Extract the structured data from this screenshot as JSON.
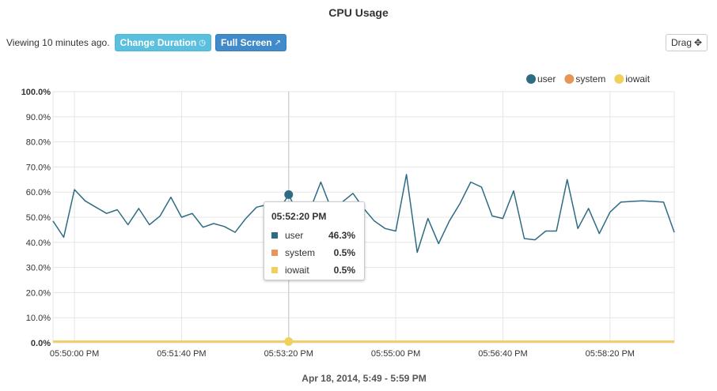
{
  "title": "CPU Usage",
  "toolbar": {
    "viewing_text": "Viewing 10 minutes ago.",
    "change_duration_label": "Change Duration",
    "full_screen_label": "Full Screen",
    "drag_label": "Drag"
  },
  "icons": {
    "clock": "clock-icon",
    "expand": "expand-icon",
    "move": "move-icon"
  },
  "tooltip": {
    "time": "05:52:20 PM",
    "rows": [
      {
        "name": "user",
        "value": "46.3%",
        "color": "#2e6c84"
      },
      {
        "name": "system",
        "value": "0.5%",
        "color": "#e8955a"
      },
      {
        "name": "iowait",
        "value": "0.5%",
        "color": "#f2d05e"
      }
    ]
  },
  "date_range": "Apr 18, 2014, 5:49 - 5:59 PM",
  "chart_data": {
    "type": "line",
    "title": "CPU Usage",
    "xlabel": "Apr 18, 2014, 5:49 - 5:59 PM",
    "ylabel": "",
    "ylim": [
      0,
      100
    ],
    "y_ticks": [
      "0.0%",
      "10.0%",
      "20.0%",
      "30.0%",
      "40.0%",
      "50.0%",
      "60.0%",
      "70.0%",
      "80.0%",
      "90.0%",
      "100.0%"
    ],
    "x_ticks": [
      "05:50:00 PM",
      "05:51:40 PM",
      "05:53:20 PM",
      "05:55:00 PM",
      "05:56:40 PM",
      "05:58:20 PM"
    ],
    "x_tick_seconds": [
      60,
      160,
      260,
      360,
      460,
      560
    ],
    "x_range_seconds": [
      40,
      620
    ],
    "x_seconds": [
      40,
      50,
      60,
      70,
      80,
      90,
      100,
      110,
      120,
      130,
      140,
      150,
      160,
      170,
      180,
      190,
      200,
      210,
      220,
      230,
      240,
      250,
      260,
      270,
      280,
      290,
      300,
      310,
      320,
      330,
      340,
      350,
      360,
      370,
      380,
      390,
      400,
      410,
      420,
      430,
      440,
      450,
      460,
      470,
      480,
      490,
      500,
      510,
      520,
      530,
      540,
      550,
      560,
      570,
      580,
      590,
      600,
      610,
      620
    ],
    "grid": true,
    "legend_position": "top-right",
    "highlight_index": 22,
    "series": [
      {
        "name": "user",
        "color": "#2e6c84",
        "values": [
          48.5,
          42,
          61,
          56.5,
          54,
          51.5,
          53,
          47,
          53.5,
          47,
          50.5,
          58,
          50,
          51.5,
          46,
          47.5,
          46.3,
          44,
          49.5,
          54,
          55,
          52,
          59,
          50,
          53,
          64,
          53,
          56,
          59.5,
          53.5,
          48.5,
          45.5,
          44.5,
          67,
          36,
          49.5,
          39.5,
          48.5,
          55.5,
          64,
          62,
          50.5,
          49.5,
          60.5,
          41.5,
          41,
          44.5,
          44.5,
          65,
          45.5,
          53.5,
          43.5,
          52,
          56,
          56.3,
          56.5,
          56.3,
          56,
          44
        ]
      },
      {
        "name": "system",
        "color": "#e8955a",
        "values": [
          0.5,
          0.5,
          0.5,
          0.5,
          0.5,
          0.5,
          0.5,
          0.5,
          0.5,
          0.5,
          0.5,
          0.5,
          0.5,
          0.5,
          0.5,
          0.5,
          0.5,
          0.5,
          0.5,
          0.5,
          0.5,
          0.5,
          0.5,
          0.5,
          0.5,
          0.5,
          0.5,
          0.5,
          0.5,
          0.5,
          0.5,
          0.5,
          0.5,
          0.5,
          0.5,
          0.5,
          0.5,
          0.5,
          0.5,
          0.5,
          0.5,
          0.5,
          0.5,
          0.5,
          0.5,
          0.5,
          0.5,
          0.5,
          0.5,
          0.5,
          0.5,
          0.5,
          0.5,
          0.5,
          0.5,
          0.5,
          0.5,
          0.5,
          0.5
        ]
      },
      {
        "name": "iowait",
        "color": "#f2d05e",
        "values": [
          0.5,
          0.5,
          0.5,
          0.5,
          0.5,
          0.5,
          0.5,
          0.5,
          0.5,
          0.5,
          0.5,
          0.5,
          0.5,
          0.5,
          0.5,
          0.5,
          0.5,
          0.5,
          0.5,
          0.5,
          0.5,
          0.5,
          0.5,
          0.5,
          0.5,
          0.5,
          0.5,
          0.5,
          0.5,
          0.5,
          0.5,
          0.5,
          0.5,
          0.5,
          0.5,
          0.5,
          0.5,
          0.5,
          0.5,
          0.5,
          0.5,
          0.5,
          0.5,
          0.5,
          0.5,
          0.5,
          0.5,
          0.5,
          0.5,
          0.5,
          0.5,
          0.5,
          0.5,
          0.5,
          0.5,
          0.5,
          0.5,
          0.5,
          0.5
        ]
      }
    ]
  }
}
